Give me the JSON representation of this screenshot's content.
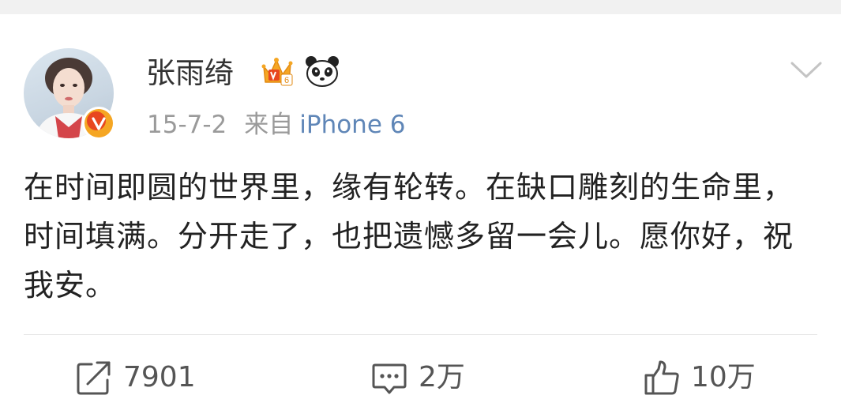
{
  "author": {
    "name": "张雨绮"
  },
  "post": {
    "date": "15-7-2",
    "via_label": "来自",
    "source": "iPhone 6",
    "text": "在时间即圆的世界里，缘有轮转。在缺口雕刻的生命里，时间填满。分开走了，也把遗憾多留一会儿。愿你好，祝我安。"
  },
  "actions": {
    "repost_count": "7901",
    "comment_count": "2万",
    "like_count": "10万"
  },
  "icons": {
    "avatar_badge": "verified-v-icon",
    "crown": "crown-level-icon",
    "panda": "panda-icon",
    "more": "chevron-down-icon",
    "repost": "repost-icon",
    "comment": "comment-icon",
    "like": "thumbs-up-icon"
  },
  "colors": {
    "link": "#5f86b7",
    "meta": "#9a9a9a",
    "badge": "#e8471f",
    "crown": "#f5a623"
  }
}
